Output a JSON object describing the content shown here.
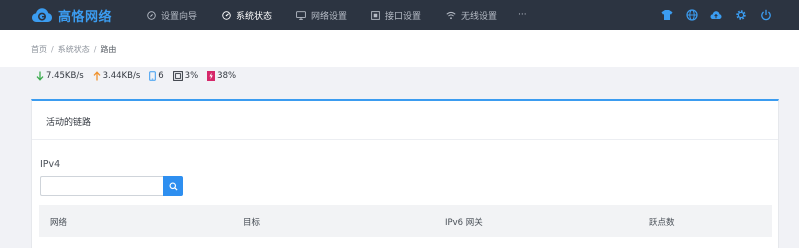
{
  "brand": {
    "name": "高恪网络",
    "color": "#3b9cf0"
  },
  "nav": {
    "items": [
      {
        "label": "设置向导",
        "icon": "compass-icon",
        "active": false
      },
      {
        "label": "系统状态",
        "icon": "gauge-icon",
        "active": true
      },
      {
        "label": "网络设置",
        "icon": "monitor-icon",
        "active": false
      },
      {
        "label": "接口设置",
        "icon": "interface-icon",
        "active": false
      },
      {
        "label": "无线设置",
        "icon": "wifi-icon",
        "active": false
      }
    ],
    "more": "···",
    "right_icons": [
      "tshirt-icon",
      "globe-icon",
      "cloud-upload-icon",
      "gear-icon",
      "power-icon"
    ]
  },
  "breadcrumb": {
    "items": [
      "首页",
      "系统状态",
      "路由"
    ],
    "separator": "/"
  },
  "status": {
    "download": "7.45KB/s",
    "upload": "3.44KB/s",
    "devices": "6",
    "cpu": "3%",
    "memory": "38%"
  },
  "card": {
    "title": "活动的链路",
    "ipv4_label": "IPv4",
    "search_value": "",
    "table_headers": [
      "网络",
      "目标",
      "IPv6 网关",
      "跃点数"
    ]
  },
  "colors": {
    "topbar": "#2c3441",
    "accent": "#2e8ff0",
    "download": "#3cab4f",
    "upload": "#f0922e",
    "devices": "#3b9cf0",
    "memory": "#d6286a"
  }
}
